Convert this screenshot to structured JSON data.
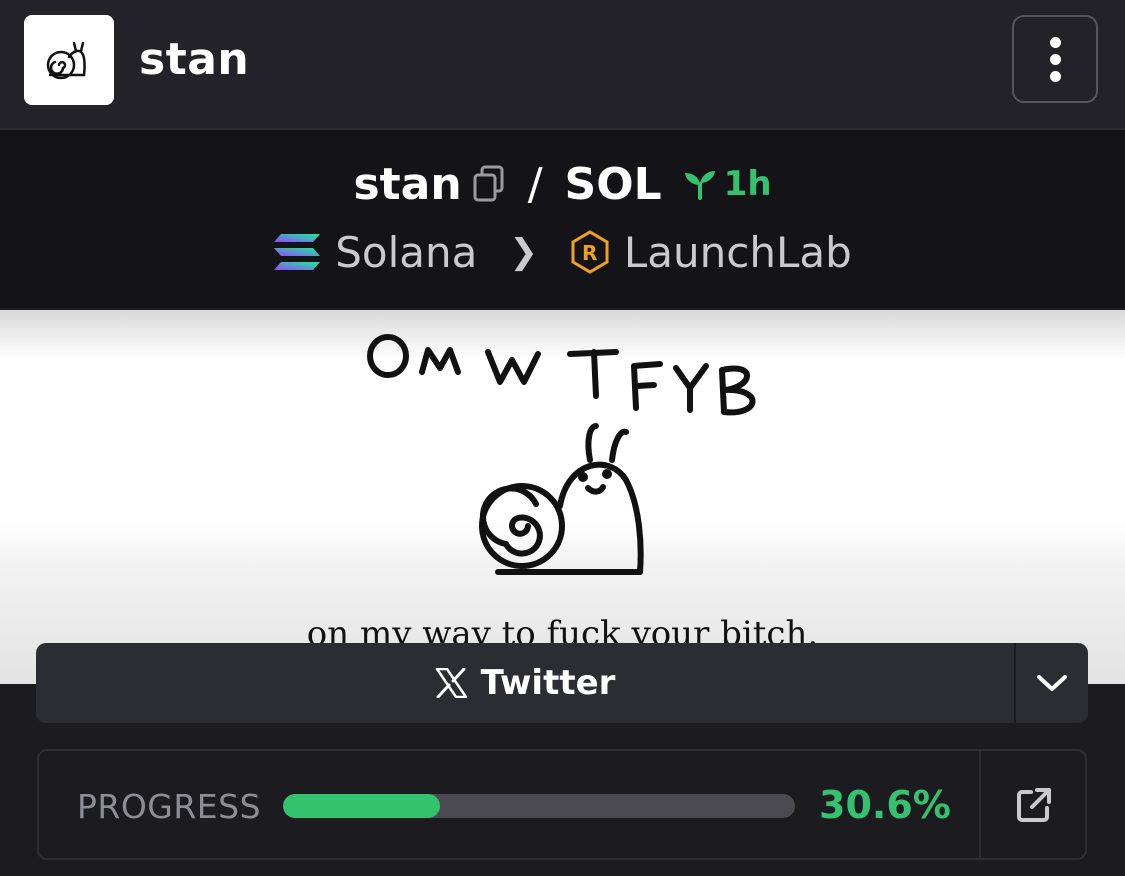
{
  "header": {
    "token_name": "stan",
    "menu_icon": "kebab-menu-icon"
  },
  "pair": {
    "base": "stan",
    "separator": "/",
    "quote": "SOL",
    "age": "1h",
    "chain": "Solana",
    "dex": "LaunchLab"
  },
  "banner": {
    "caption": "on my way to fuck your bitch.",
    "handwritten_heading": "OMWTFYB"
  },
  "social": {
    "twitter_label": "Twitter"
  },
  "progress": {
    "label": "PROGRESS",
    "value_text": "30.6%",
    "value": 30.6
  },
  "colors": {
    "accent_green": "#35c26f",
    "background": "#1b1b20",
    "header": "#222228"
  }
}
